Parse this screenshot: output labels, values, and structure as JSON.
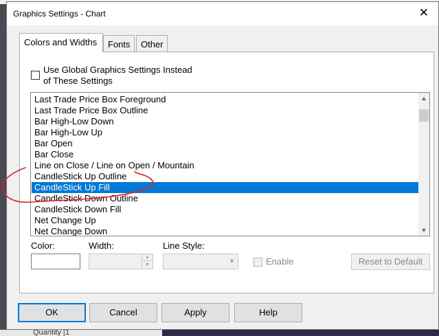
{
  "window": {
    "title": "Graphics Settings  - Chart",
    "close_glyph": "✕"
  },
  "tabs": [
    {
      "label": "Colors and Widths",
      "active": true
    },
    {
      "label": "Fonts",
      "active": false
    },
    {
      "label": "Other",
      "active": false
    }
  ],
  "global_checkbox": {
    "checked": false,
    "label_line1": "Use Global Graphics Settings Instead",
    "label_line2": "of These Settings"
  },
  "list": {
    "items": [
      "Last Trade Price Box Foreground",
      "Last Trade Price Box Outline",
      "Bar High-Low Down",
      "Bar High-Low Up",
      "Bar Open",
      "Bar Close",
      "Line on Close / Line on Open / Mountain",
      "CandleStick Up Outline",
      "CandleStick Up Fill",
      "CandleStick Down Outline",
      "CandleStick Down Fill",
      "Net Change Up",
      "Net Change Down"
    ],
    "selected_index": 8,
    "selected_color": "#0078d7"
  },
  "controls": {
    "color_label": "Color:",
    "width_label": "Width:",
    "line_style_label": "Line Style:",
    "enable_label": "Enable",
    "reset_label": "Reset to Default"
  },
  "buttons": {
    "ok": "OK",
    "cancel": "Cancel",
    "apply": "Apply",
    "help": "Help"
  },
  "background": {
    "partial_text": "Quantity [1"
  },
  "annotation_color": "#e02020"
}
